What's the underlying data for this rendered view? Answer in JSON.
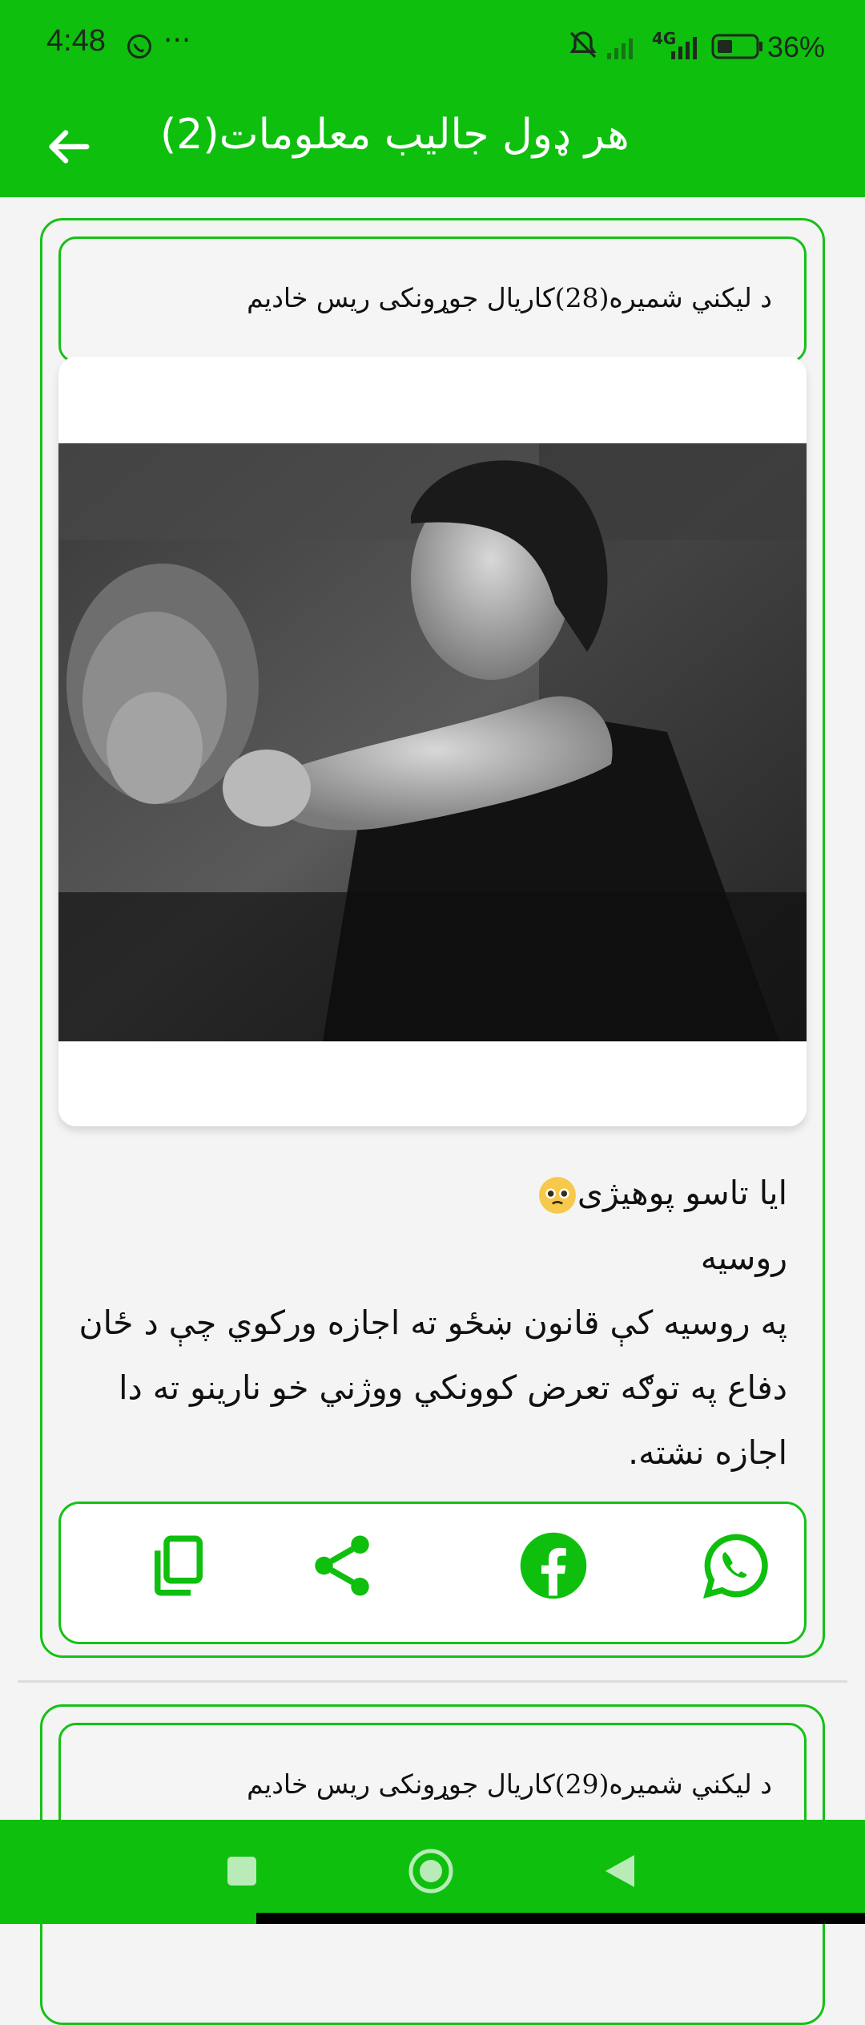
{
  "status_bar": {
    "time": "4:48",
    "more": "···",
    "battery_percent": "36%",
    "network": "4G",
    "icons": [
      "whatsapp-status-icon",
      "mute-icon",
      "signal-icon",
      "battery-icon"
    ]
  },
  "app_bar": {
    "title": "هر ډول جالیب معلومات(2)",
    "back_icon": "arrow-back-icon"
  },
  "posts": [
    {
      "header": "د ليکني شميره(28)کاريال جوړونکی ريس خاديم",
      "image": "black-and-white photo of a woman striking a man",
      "lines": [
        "ایا تاسو پوهیژی",
        "روسیه",
        "په روسیه کې قانون ښځو ته اجازه ورکوي چې د ځان",
        "دفاع په توګه  تعرض کوونکي ووژني خو نارینو ته دا",
        "اجازه نشته."
      ],
      "actions": [
        {
          "name": "copy",
          "icon": "copy-icon"
        },
        {
          "name": "share",
          "icon": "share-icon"
        },
        {
          "name": "facebook",
          "icon": "facebook-icon"
        },
        {
          "name": "whatsapp",
          "icon": "whatsapp-icon"
        }
      ]
    },
    {
      "header": "د ليکني شميره(29)کاريال جوړونکی ريس خاديم"
    }
  ],
  "nav_bar": {
    "recents_icon": "square-icon",
    "home_icon": "circle-icon",
    "back_icon": "triangle-back-icon"
  },
  "colors": {
    "accent": "#0ebf0e",
    "border": "#16c116"
  }
}
